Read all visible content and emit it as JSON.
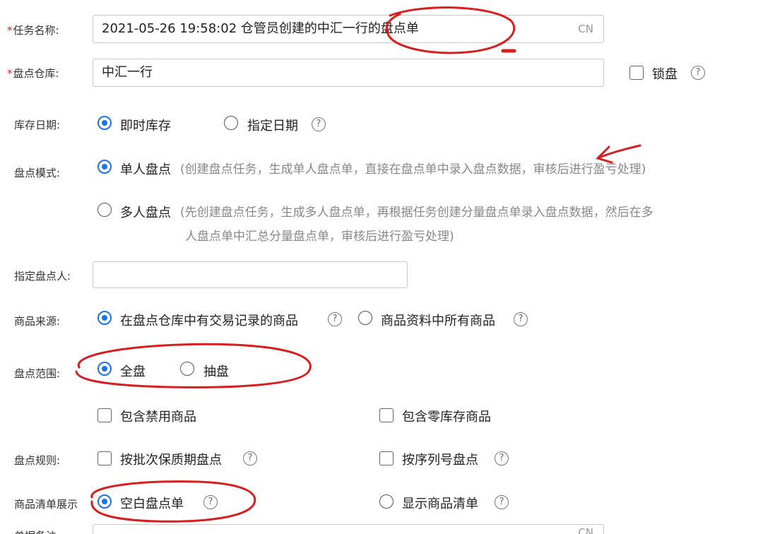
{
  "form": {
    "task_name": {
      "required": "*",
      "label": "任务名称:",
      "value": "2021-05-26 19:58:02  仓管员创建的中汇一行的盘点单",
      "suffix": "CN"
    },
    "warehouse": {
      "required": "*",
      "label": "盘点仓库:",
      "value": "中汇一行",
      "lock_label": "锁盘"
    },
    "stock_date": {
      "label": "库存日期:",
      "options": [
        "即时库存",
        "指定日期"
      ],
      "selected": "即时库存"
    },
    "mode": {
      "label": "盘点模式:",
      "options": [
        {
          "label": "单人盘点",
          "desc": "(创建盘点任务，生成单人盘点单，直接在盘点单中录入盘点数据，审核后进行盈亏处理)"
        },
        {
          "label": "多人盘点",
          "desc_line1": "(先创建盘点任务，生成多人盘点单，再根据任务创建分量盘点单录入盘点数据，然后在多",
          "desc_line2": "人盘点单中汇总分量盘点单，审核后进行盈亏处理)"
        }
      ],
      "selected": "单人盘点"
    },
    "counter": {
      "label": "指定盘点人:",
      "value": ""
    },
    "source": {
      "label": "商品来源:",
      "options": [
        "在盘点仓库中有交易记录的商品",
        "商品资料中所有商品"
      ],
      "selected": "在盘点仓库中有交易记录的商品"
    },
    "scope": {
      "label": "盘点范围:",
      "options": [
        "全盘",
        "抽盘"
      ],
      "selected": "全盘",
      "checks": [
        "包含禁用商品",
        "包含零库存商品"
      ]
    },
    "rules": {
      "label": "盘点规则:",
      "checks": [
        "按批次保质期盘点",
        "按序列号盘点"
      ]
    },
    "display": {
      "label": "商品清单展示",
      "options": [
        "空白盘点单",
        "显示商品清单"
      ],
      "selected": "空白盘点单"
    },
    "remark": {
      "label": "单据备注:",
      "suffix": "CN"
    }
  },
  "help_icon_glyph": "?",
  "annotation_color": "#d81e1e"
}
